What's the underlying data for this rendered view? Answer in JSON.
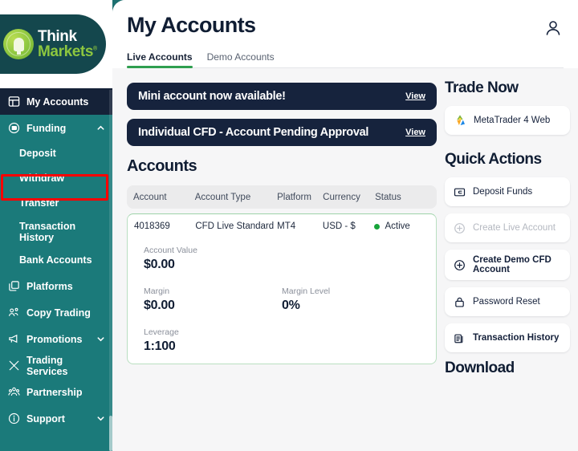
{
  "brand": {
    "logo_think": "Think",
    "logo_markets": "Markets",
    "logo_reg_mark": "®",
    "accent_green": "#8cc63f",
    "sidebar_teal": "#1b7a7a",
    "active_navy": "#152238"
  },
  "sidebar": {
    "items": [
      {
        "label": "My Accounts",
        "icon": "grid-dashboard-icon",
        "active": true,
        "chevron": null
      },
      {
        "label": "Funding",
        "icon": "wallet-icon",
        "active": false,
        "chevron": "chevron-up"
      },
      {
        "label": "Platforms",
        "icon": "platforms-icon",
        "active": false,
        "chevron": null
      },
      {
        "label": "Copy Trading",
        "icon": "copy-trading-icon",
        "active": false,
        "chevron": null
      },
      {
        "label": "Promotions",
        "icon": "megaphone-icon",
        "active": false,
        "chevron": "chevron-down"
      },
      {
        "label": "Trading Services",
        "icon": "tools-icon",
        "active": false,
        "chevron": null
      },
      {
        "label": "Partnership",
        "icon": "partnership-icon",
        "active": false,
        "chevron": null
      },
      {
        "label": "Support",
        "icon": "info-icon",
        "active": false,
        "chevron": "chevron-down"
      }
    ],
    "funding_subitems": [
      {
        "label": "Deposit",
        "highlighted": false
      },
      {
        "label": "Withdraw",
        "highlighted": true
      },
      {
        "label": "Transfer",
        "highlighted": false
      },
      {
        "label": "Transaction History",
        "highlighted": false
      },
      {
        "label": "Bank Accounts",
        "highlighted": false
      }
    ],
    "highlight_color": "#ff0000"
  },
  "header": {
    "title": "My Accounts",
    "avatar_icon": "person-icon",
    "tabs": [
      {
        "label": "Live Accounts",
        "active": true
      },
      {
        "label": "Demo Accounts",
        "active": false
      }
    ]
  },
  "banners": [
    {
      "text": "Mini account now available!",
      "action": "View"
    },
    {
      "text": "Individual CFD - Account Pending Approval",
      "action": "View"
    }
  ],
  "accounts_section": {
    "title": "Accounts",
    "columns": [
      "Account",
      "Account Type",
      "Platform",
      "Currency",
      "Status"
    ],
    "rows": [
      {
        "account": "4018369",
        "account_type": "CFD Live Standard",
        "platform": "MT4",
        "currency": "USD - $",
        "status": "Active",
        "status_color": "#17a43a"
      }
    ],
    "stats": [
      {
        "label": "Account Value",
        "value": "$0.00"
      },
      {
        "label": "",
        "value": ""
      },
      {
        "label": "Margin",
        "value": "$0.00"
      },
      {
        "label": "Margin Level",
        "value": "0%"
      },
      {
        "label": "Leverage",
        "value": "1:100"
      }
    ]
  },
  "right_panel": {
    "trade_now_title": "Trade Now",
    "trade_now_buttons": [
      {
        "label": "MetaTrader 4 Web",
        "icon": "metatrader4-logo-icon"
      }
    ],
    "quick_actions_title": "Quick Actions",
    "quick_actions": [
      {
        "label": "Deposit Funds",
        "icon": "deposit-card-icon",
        "disabled": false,
        "bold": false
      },
      {
        "label": "Create Live Account",
        "icon": "plus-circle-icon",
        "disabled": true,
        "bold": false
      },
      {
        "label": "Create Demo CFD Account",
        "icon": "plus-circle-icon",
        "disabled": false,
        "bold": true
      },
      {
        "label": "Password Reset",
        "icon": "lock-icon",
        "disabled": false,
        "bold": false
      },
      {
        "label": "Transaction History",
        "icon": "documents-icon",
        "disabled": false,
        "bold": false
      }
    ],
    "download_title": "Download"
  }
}
